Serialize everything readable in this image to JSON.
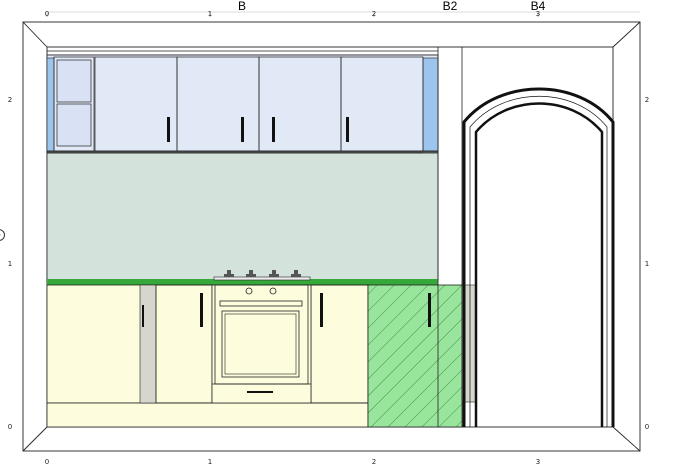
{
  "rulers": {
    "top": [
      "0",
      "1",
      "2",
      "3"
    ],
    "bottom": [
      "0",
      "1",
      "2",
      "3"
    ],
    "left": [
      "2",
      "1",
      "0"
    ],
    "right": [
      "2",
      "1",
      "0"
    ]
  },
  "section_labels": [
    "B",
    "B2",
    "B4"
  ],
  "colors": {
    "wall_cabinets": "#e1e8f6",
    "wall_cabinet_sides": "#9cc4ec",
    "backsplash": "#d3e3dc",
    "countertop": "#36a83a",
    "base_cabinets": "#fdfddd",
    "selected_cabinet": "#9ae59d",
    "hatch": "#3c9a46",
    "filler_panel": "#d6d6cc"
  }
}
